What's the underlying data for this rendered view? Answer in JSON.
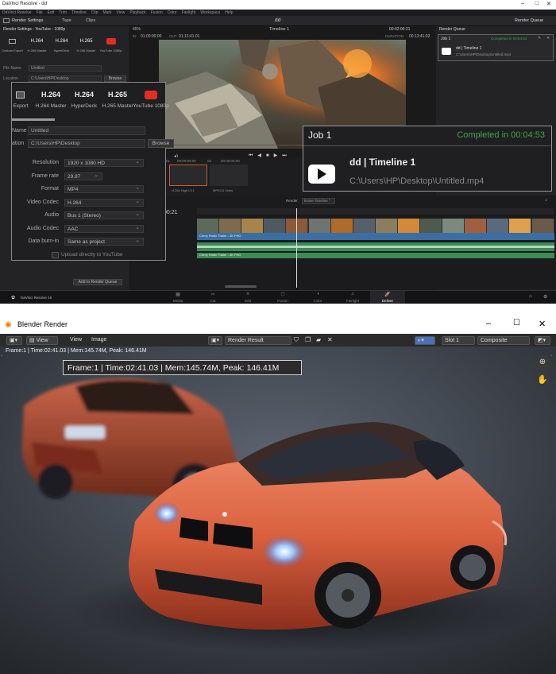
{
  "resolve": {
    "title": "DaVinci Resolve - dd",
    "menu": [
      "DaVinci Resolve",
      "File",
      "Edit",
      "Trim",
      "Timeline",
      "Clip",
      "Mark",
      "View",
      "Playback",
      "Fusion",
      "Color",
      "Fairlight",
      "Workspace",
      "Help"
    ],
    "toolbar": {
      "render_settings": "Render Settings",
      "tape": "Tape",
      "clips": "Clips",
      "project_name": "dd",
      "render_queue": "Render Queue"
    },
    "render_settings_header": "Render Settings - YouTube - 1080p",
    "presets": [
      {
        "short": "",
        "label": "Custom Export"
      },
      {
        "short": "H.264",
        "label": "H.264 Master"
      },
      {
        "short": "H.264",
        "label": "HyperDeck"
      },
      {
        "short": "H.265",
        "label": "H.265 Master"
      },
      {
        "short": "",
        "label": "YouTube 1080p"
      }
    ],
    "small_fields": {
      "file_name_label": "File Name",
      "file_name": "Untitled",
      "location_label": "Location",
      "location": "C:\\Users\\HP\\Desktop",
      "browse": "Browse"
    },
    "viewer": {
      "zoom": "45%",
      "timeline": "Timeline 1",
      "tc_in": "01:00:00:00",
      "tc_out": "01:13:41:01",
      "tc_current": "00:02:00:21",
      "duration_label": "DURATION",
      "duration": "00:13:41:02",
      "tc_left": "01:00:00:00",
      "in_label": "IN",
      "out_label": "OUT"
    },
    "clips_strip": {
      "c1": "01",
      "c2": "02",
      "tc1": "00:00:00:00",
      "tc2": "00:00:00:00",
      "name1": "H.264 High L5.1",
      "name2": "MPEG4 Video"
    },
    "timeline": {
      "tc": "00:21",
      "render_label": "Render",
      "render_mode": "Entire Timeline",
      "clip_label": "Cerny Hratic Trailer - 4K FHD",
      "add_queue": "Add to Render Queue"
    },
    "pages": [
      "Media",
      "Cut",
      "Edit",
      "Fusion",
      "Color",
      "Fairlight",
      "Deliver"
    ],
    "brand": "DaVinci Resolve 16",
    "queue": {
      "header": "Render Queue",
      "job": "Job 1",
      "completed": "Completed in 00:04:53",
      "name": "dd | Timeline 1",
      "path": "C:\\Users\\HP\\Desktop\\Untitled.mp4"
    },
    "popup": {
      "presets": [
        {
          "short": "",
          "label": "Export"
        },
        {
          "short": "H.264",
          "label": "H.264 Master"
        },
        {
          "short": "H.264",
          "label": "HyperDeck"
        },
        {
          "short": "H.265",
          "label": "H.265 Master"
        },
        {
          "short": "",
          "label": "YouTube 1080p"
        }
      ],
      "name_label": "Name",
      "name": "Untitled",
      "location_label": "ation",
      "location": "C:\\Users\\HP\\Desktop",
      "browse": "Browse",
      "rows": [
        {
          "label": "Resolution",
          "value": "1920 x 1080 HD"
        },
        {
          "label": "Frame rate",
          "value": "29.97"
        },
        {
          "label": "Format",
          "value": "MP4"
        },
        {
          "label": "Video Codec",
          "value": "H.264"
        },
        {
          "label": "Audio",
          "value": "Bus 1 (Stereo)"
        },
        {
          "label": "Audio Codec",
          "value": "AAC"
        },
        {
          "label": "Data burn-in",
          "value": "Same as project"
        }
      ],
      "upload": "Upload directly to YouTube"
    },
    "job_popup": {
      "job": "Job 1",
      "completed": "Completed in 00:04:53",
      "name": "dd | Timeline 1",
      "path": "C:\\Users\\HP\\Desktop\\Untitled.mp4"
    }
  },
  "blender": {
    "title": "Blender Render",
    "menu_view": "View",
    "menu_view2": "View",
    "menu_image": "Image",
    "result": "Render Result",
    "slot": "Slot 1",
    "composite": "Composite",
    "info": "Frame:1 | Time:02:41.03 | Mem:145.74M, Peak: 146.41M",
    "info_big": "Frame:1 | Time:02:41.03 | Mem:145.74M, Peak: 146.41M"
  },
  "colors": {
    "resolve_bg": "#1c1c1e",
    "youtube_red": "#e52d27",
    "completed_green": "#3fa34d",
    "blender_bg": "#303030",
    "car_orange": "#d9603e"
  }
}
